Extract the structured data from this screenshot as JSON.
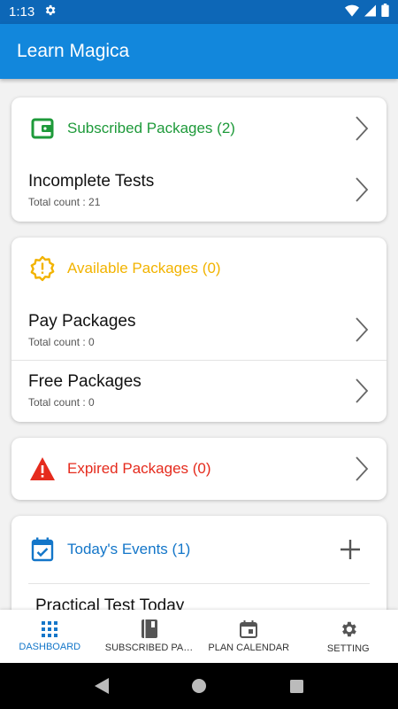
{
  "status_bar": {
    "time": "1:13"
  },
  "app_bar": {
    "title": "Learn Magica"
  },
  "cards": {
    "subscribed": {
      "title": "Subscribed Packages (2)",
      "color": "#1e9a3a",
      "icon": "wallet-icon",
      "rows": [
        {
          "title": "Incomplete Tests",
          "sub": "Total count : 21"
        }
      ]
    },
    "available": {
      "title": "Available Packages (0)",
      "color": "#f2b300",
      "icon": "badge-alert-icon",
      "rows": [
        {
          "title": "Pay Packages",
          "sub": "Total count : 0"
        },
        {
          "title": "Free Packages",
          "sub": "Total count : 0"
        }
      ]
    },
    "expired": {
      "title": "Expired Packages (0)",
      "color": "#e52b1d",
      "icon": "warning-icon"
    },
    "events": {
      "title": "Today's Events (1)",
      "color": "#1376c9",
      "icon": "calendar-check-icon",
      "partial_row": "Practical Test Today"
    }
  },
  "bottom_nav": {
    "items": [
      {
        "label": "DASHBOARD",
        "icon": "grid-icon",
        "active": true
      },
      {
        "label": "SUBSCRIBED PACKAGES",
        "icon": "book-icon",
        "active": false
      },
      {
        "label": "PLAN CALENDAR",
        "icon": "calendar-icon",
        "active": false
      },
      {
        "label": "SETTING",
        "icon": "gear-icon",
        "active": false
      }
    ]
  }
}
